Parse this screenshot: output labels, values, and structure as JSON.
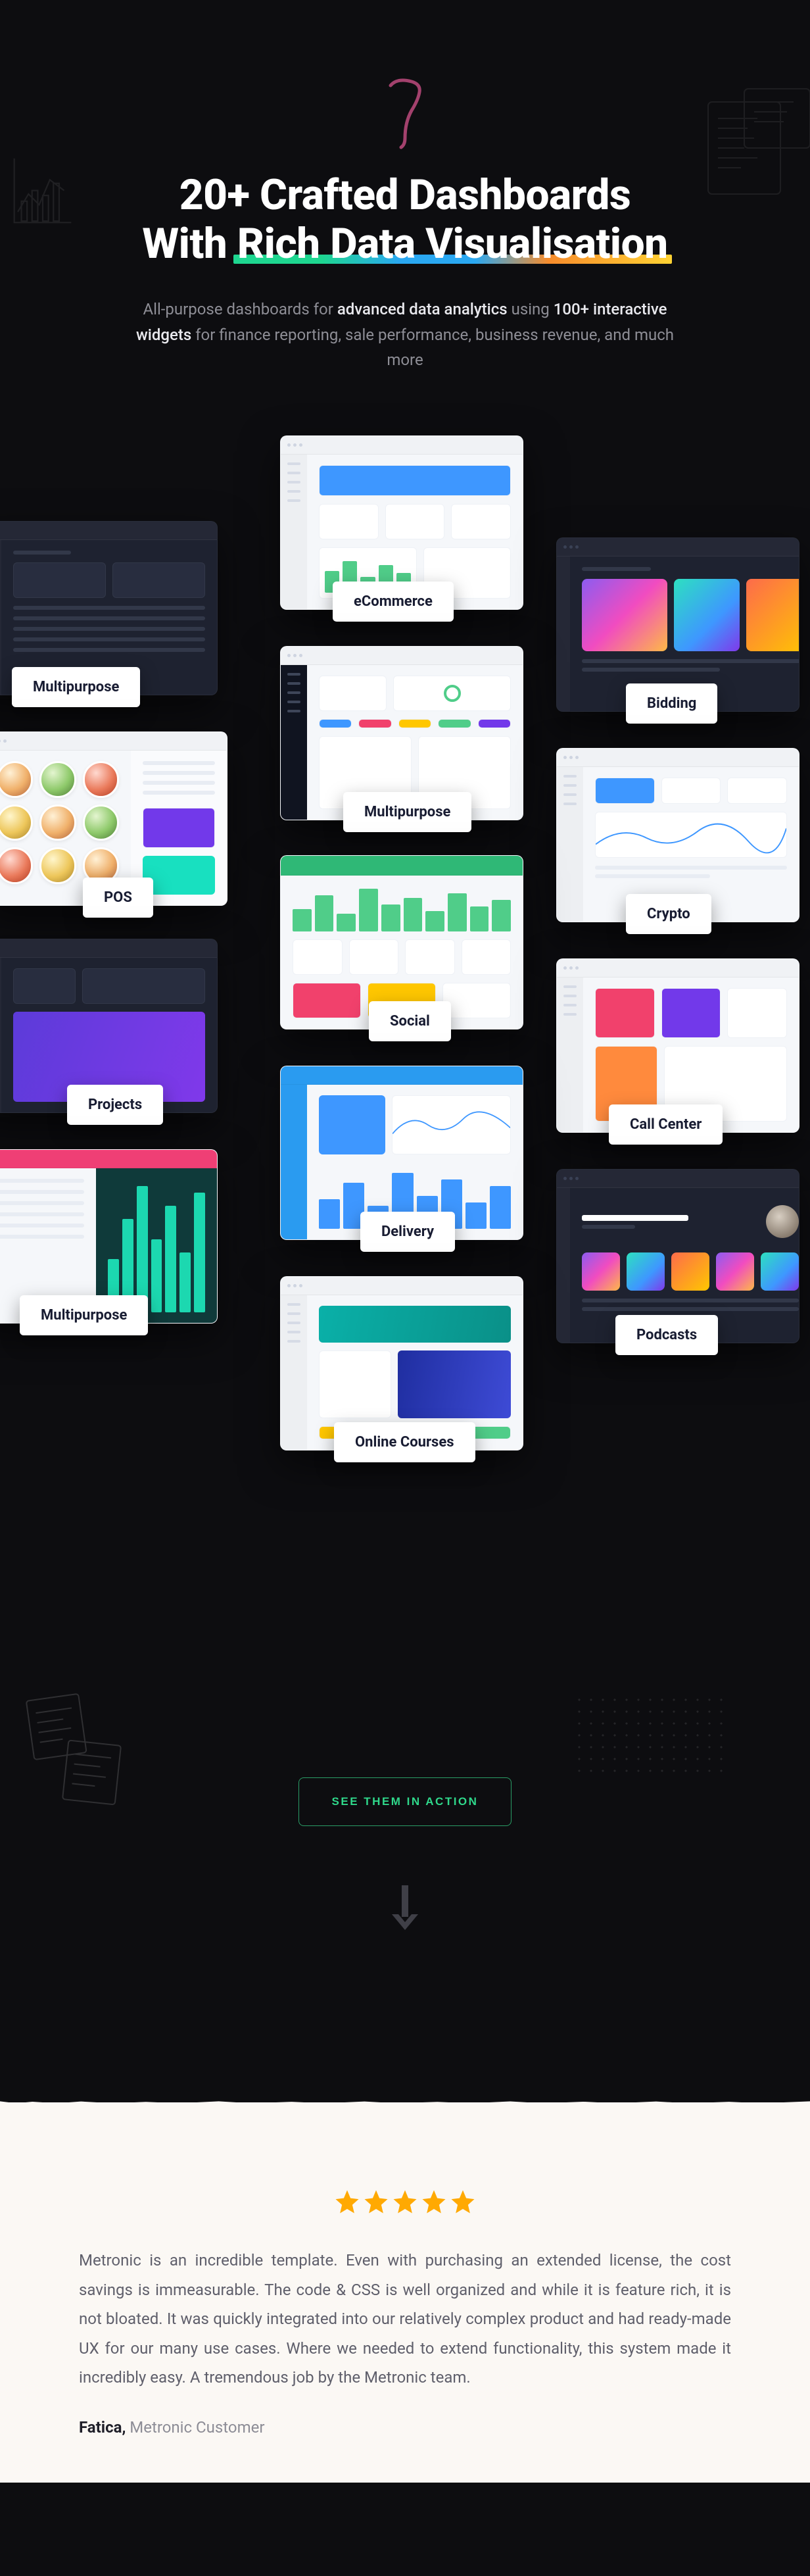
{
  "hero": {
    "headline_line1": "20+ Crafted Dashboards",
    "headline_line2_a": "With ",
    "headline_line2_b": "Rich Data Visualisation",
    "sub_1": "All-purpose dashboards for ",
    "sub_hl1": "advanced data analytics",
    "sub_2": " using ",
    "sub_hl2": "100+ interactive widgets",
    "sub_3": " for finance reporting, sale performance, business revenue, and much more"
  },
  "cards": {
    "c1": "eCommerce",
    "c2": "Bidding",
    "c3": "Multipurpose",
    "c4": "Multipurpose",
    "c5": "POS",
    "c6": "Crypto",
    "c7": "Social",
    "c8": "Projects",
    "c9": "Call Center",
    "c10": "Delivery",
    "c11": "Multipurpose",
    "c12": "Podcasts",
    "c13": "Online Courses"
  },
  "cta": {
    "label": "SEE THEM IN ACTION"
  },
  "testimonial": {
    "quote": "Metronic is an incredible template. Even with purchasing an extended license, the cost savings is immeasurable. The code & CSS is well organized and while it is feature rich, it is not bloated. It was quickly integrated into our relatively complex product and had ready-made UX for our many use cases. Where we needed to extend functionality, this system made it incredibly easy. A tremendous job by the Metronic team.",
    "name": "Fatica,",
    "role": "  Metronic Customer"
  }
}
